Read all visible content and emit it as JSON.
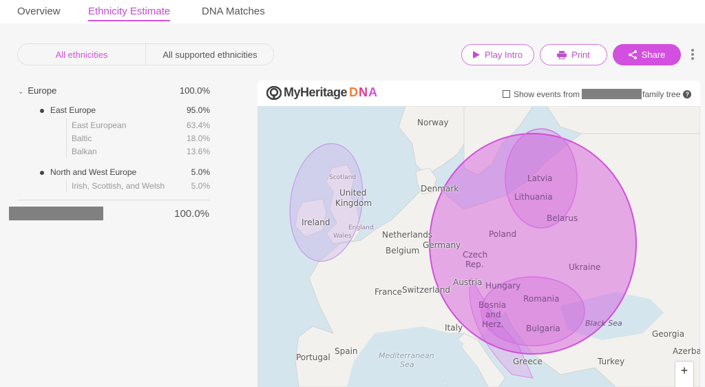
{
  "nav": {
    "tabs": [
      {
        "label": "Overview",
        "active": false
      },
      {
        "label": "Ethnicity Estimate",
        "active": true
      },
      {
        "label": "DNA Matches",
        "active": false
      }
    ]
  },
  "filter": {
    "options": [
      "All ethnicities",
      "All supported ethnicities"
    ],
    "selected": "All ethnicities"
  },
  "toolbar": {
    "play_intro": "Play Intro",
    "print": "Print",
    "share": "Share",
    "more_icon": "kebab-icon"
  },
  "ethnicity": {
    "region": {
      "label": "Europe",
      "value": "100.0%"
    },
    "groups": [
      {
        "label": "East Europe",
        "value": "95.0%",
        "items": [
          {
            "label": "East European",
            "value": "63.4%"
          },
          {
            "label": "Baltic",
            "value": "18.0%"
          },
          {
            "label": "Balkan",
            "value": "13.6%"
          }
        ]
      },
      {
        "label": "North and West Europe",
        "value": "5.0%",
        "items": [
          {
            "label": "Irish, Scottish, and Welsh",
            "value": "5.0%"
          }
        ]
      }
    ],
    "total_value": "100.0%"
  },
  "map": {
    "brand": "MyHeritage",
    "brand_suffix": [
      "D",
      "N",
      "A"
    ],
    "events_prefix": "Show events from",
    "events_suffix": "family tree",
    "events_checked": false,
    "zoom_in": "+",
    "accent": "#d34fdf",
    "labels": {
      "norway": "Norway",
      "denmark": "Denmark",
      "scotland": "Scotland",
      "uk1": "United",
      "uk2": "Kingdom",
      "ireland": "Ireland",
      "england": "England",
      "wales": "Wales",
      "netherlands": "Netherlands",
      "germany": "Germany",
      "belgium": "Belgium",
      "france": "France",
      "switzerland": "Switzerland",
      "italy": "Italy",
      "spain": "Spain",
      "portugal": "Portugal",
      "med1": "Mediterranean",
      "med2": "Sea",
      "latvia": "Latvia",
      "lithuania": "Lithuania",
      "belarus": "Belarus",
      "poland": "Poland",
      "czech1": "Czech",
      "czech2": "Rep.",
      "austria": "Austria",
      "hungary": "Hungary",
      "ukraine": "Ukraine",
      "romania": "Romania",
      "bosnia1": "Bosnia",
      "bosnia2": "and",
      "bosnia3": "Herz.",
      "bulgaria": "Bulgaria",
      "blacksea": "Black Sea",
      "greece": "Greece",
      "turkey": "Turkey",
      "georgia": "Georgia",
      "azerbaijan": "Azerba"
    }
  }
}
